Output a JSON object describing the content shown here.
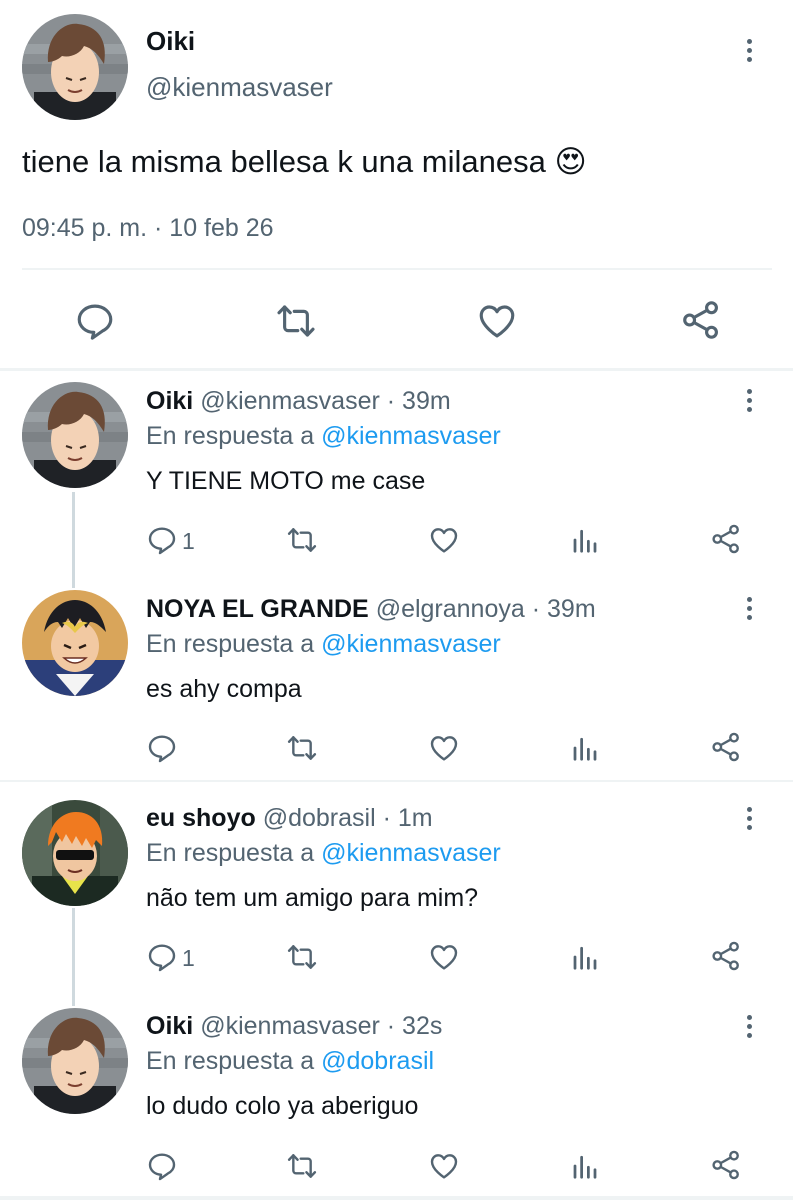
{
  "main_tweet": {
    "name": "Oiki",
    "handle": "@kienmasvaser",
    "text": "tiene la misma bellesa k una milanesa",
    "emoji": "😍",
    "time": "09:45 p. m. · 10 feb 26"
  },
  "replies": [
    {
      "name": "Oiki",
      "handle": "@kienmasvaser",
      "time": "· 39m",
      "reply_prefix": "En respuesta a",
      "reply_to": "@kienmasvaser",
      "text": "Y TIENE MOTO me case",
      "reply_count": "1"
    },
    {
      "name": "NOYA EL GRANDE",
      "handle": "@elgrannoya",
      "time": "· 39m",
      "reply_prefix": "En respuesta a",
      "reply_to": "@kienmasvaser",
      "text": "es ahy compa",
      "reply_count": ""
    },
    {
      "name": "eu shoyo",
      "handle": "@dobrasil",
      "time": "· 1m",
      "reply_prefix": "En respuesta a",
      "reply_to": "@kienmasvaser",
      "text": "não tem um amigo para mim?",
      "reply_count": "1"
    },
    {
      "name": "Oiki",
      "handle": "@kienmasvaser",
      "time": "· 32s",
      "reply_prefix": "En respuesta a",
      "reply_to": "@dobrasil",
      "text": "lo dudo colo ya aberiguo",
      "reply_count": ""
    }
  ],
  "colors": {
    "text": "#0f1419",
    "secondary": "#536471",
    "link": "#1d9bf0",
    "divider": "#eff3f4"
  },
  "icons": [
    "reply-icon",
    "retweet-icon",
    "like-icon",
    "share-icon",
    "views-icon",
    "more-icon"
  ]
}
